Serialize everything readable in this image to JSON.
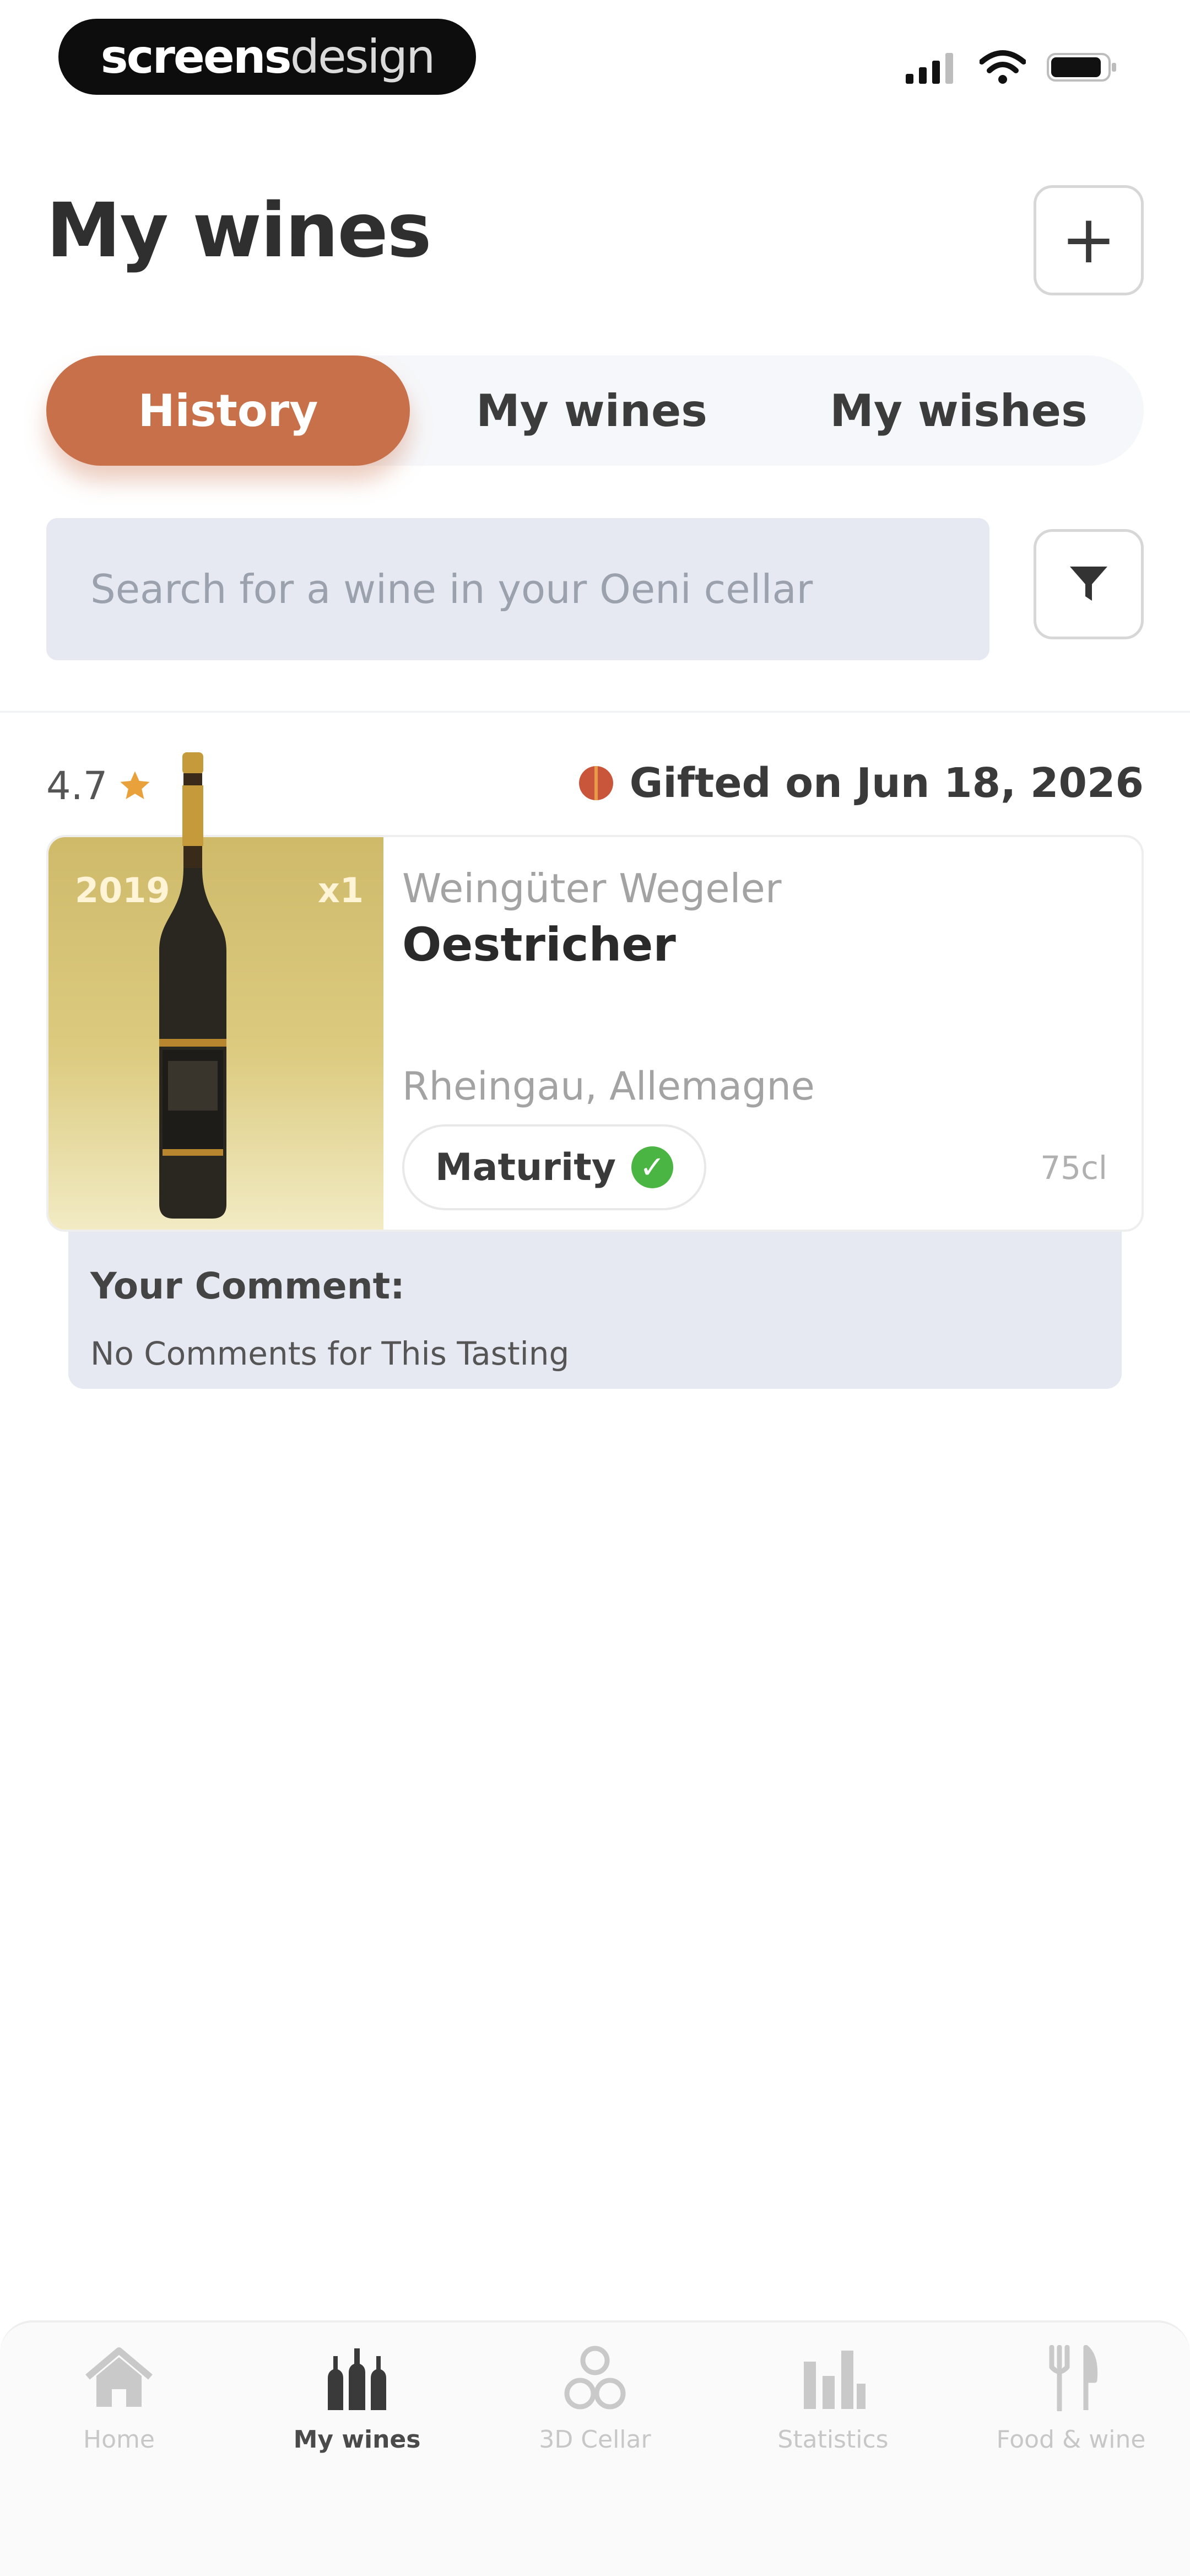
{
  "status_bar": {
    "brand_strong": "screens",
    "brand_light": "design"
  },
  "header": {
    "title": "My wines",
    "add_label": "+"
  },
  "tabs": [
    {
      "label": "History",
      "active": true
    },
    {
      "label": "My wines",
      "active": false
    },
    {
      "label": "My wishes",
      "active": false
    }
  ],
  "search": {
    "placeholder": "Search for a wine in your Oeni cellar"
  },
  "entry": {
    "rating": "4.7",
    "gifted_text": "Gifted on Jun 18, 2026",
    "year": "2019",
    "quantity": "x1",
    "producer": "Weingüter Wegeler",
    "name": "Oestricher",
    "region": "Rheingau, Allemagne",
    "maturity_label": "Maturity",
    "volume": "75cl",
    "comment_title": "Your Comment:",
    "comment_text": "No Comments for This Tasting"
  },
  "colors": {
    "accent": "#c8704a",
    "search_bg": "#e6e9f1",
    "maturity_ok": "#4bb543",
    "star": "#e9a23b"
  },
  "bottom_nav": [
    {
      "label": "Home",
      "icon": "home-icon",
      "active": false
    },
    {
      "label": "My wines",
      "icon": "bottles-icon",
      "active": true
    },
    {
      "label": "3D Cellar",
      "icon": "cellar-icon",
      "active": false
    },
    {
      "label": "Statistics",
      "icon": "chart-icon",
      "active": false
    },
    {
      "label": "Food & wine",
      "icon": "cutlery-icon",
      "active": false
    }
  ]
}
